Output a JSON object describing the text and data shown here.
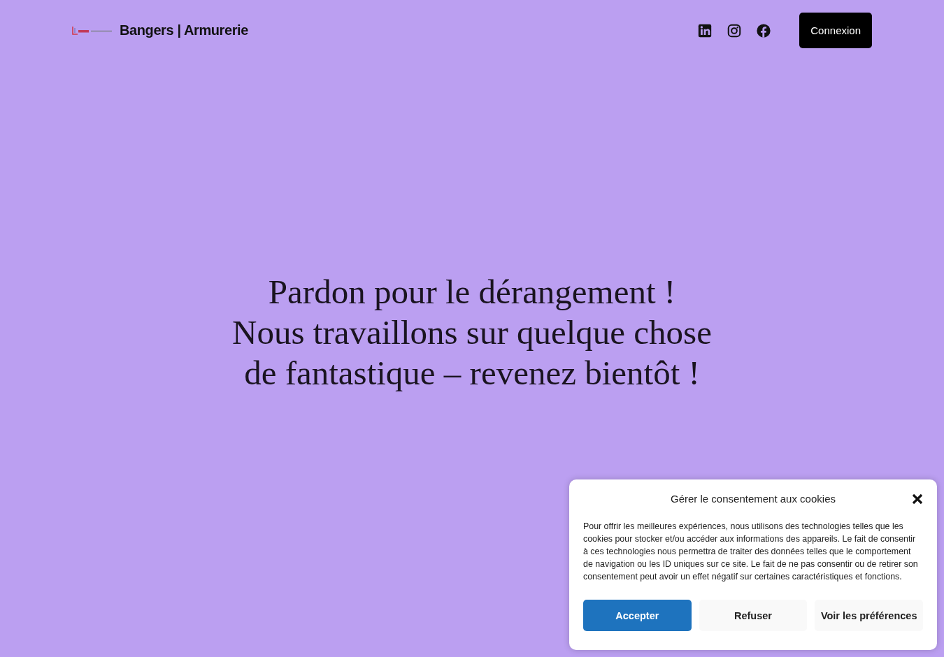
{
  "header": {
    "site_title": "Bangers | Armurerie",
    "social_links": [
      {
        "kind": "linkedin"
      },
      {
        "kind": "instagram"
      },
      {
        "kind": "facebook"
      }
    ],
    "login_button": "Connexion"
  },
  "hero": {
    "lines": [
      "Pardon pour le dérangement !",
      "Nous travaillons sur quelque chose",
      "de fantastique – revenez bientôt !"
    ]
  },
  "cookie_dialog": {
    "title": "Gérer le consentement aux cookies",
    "body": "Pour offrir les meilleures expériences, nous utilisons des technologies telles que les cookies pour stocker et/ou accéder aux informations des appareils. Le fait de consentir à ces technologies nous permettra de traiter des données telles que le comportement de navigation ou les ID uniques sur ce site. Le fait de ne pas consentir ou de retirer son consentement peut avoir un effet négatif sur certaines caractéristiques et fonctions.",
    "buttons": [
      {
        "label": "Accepter",
        "kind": "primary"
      },
      {
        "label": "Refuser",
        "kind": "secondary"
      },
      {
        "label": "Voir les préférences",
        "kind": "secondary"
      }
    ]
  }
}
